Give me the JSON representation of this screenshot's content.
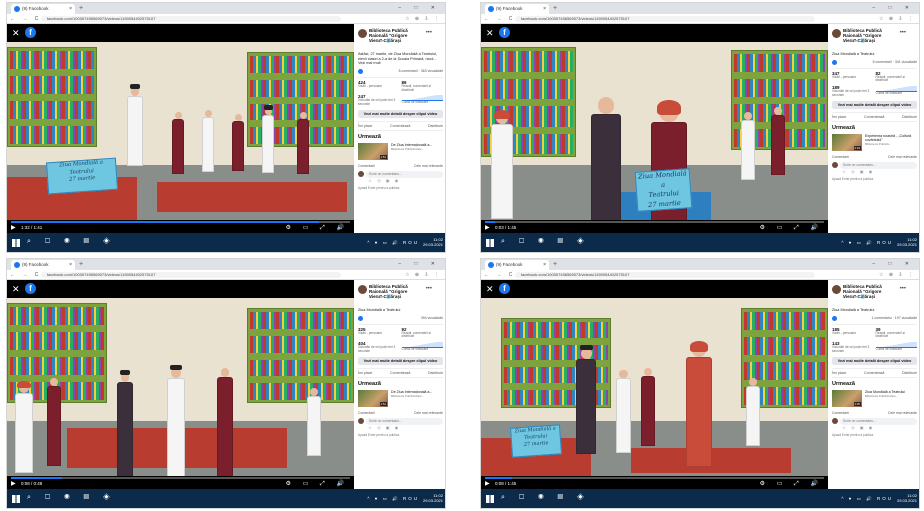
{
  "browser": {
    "tab_title": "(9) Facebook",
    "url": "facebook.com/100057496569073/videos/1159054402575107",
    "new_tab": "+",
    "window_controls": "– □ ✕",
    "nav": "← → C",
    "extensions": "☆ ⊕ ⇩ ⋮"
  },
  "video": {
    "close": "✕",
    "logo": "f",
    "sign_line1": "Ziua Mondială a",
    "sign_line2": "Teatrului",
    "sign_line3": "27 martie",
    "controls_icons": "⚙ ▭ ⤢ 🔊"
  },
  "page": {
    "name": "Biblioteca Publică Raională \"Grigore Vieru\" Călărași",
    "more": "•••"
  },
  "shots": [
    {
      "date": "27 martie · 🌐",
      "caption": "Astăzi, 27 martie, de Ziua Mondială a Teatrului, elevii clasei a 2-a de la Școala Primară, nicol... Vezi mai mult",
      "reactions_right": "8 comentarii · 363 vizualizări",
      "stat1_value": "424",
      "stat1_label": "Vizări - persoane",
      "stat2_value": "86",
      "stat2_label": "Reacții, comentarii și distribuiri",
      "stat3_value": "247",
      "stat3_label": "Vizionări de cel puțin trei 3 secunde",
      "stat4_label": "Curbă de fidelizare",
      "next1_title": "De Ziua Internațională a...",
      "next1_sub": "Biblioteca Publică Raio...",
      "next1_dur": "1:51",
      "video_time": "1:32 / 1:41",
      "progress": 0.91
    },
    {
      "date": "27 martie · 🌐",
      "caption": "Ziua Mondială a Teatrului",
      "reactions_right": "5 comentarii · 341 vizualizări",
      "stat1_value": "347",
      "stat1_label": "Vizări - persoane",
      "stat2_value": "82",
      "stat2_label": "Reacții, comentarii și distribuiri",
      "stat3_value": "189",
      "stat3_label": "Vizionări de cel puțin trei 3 secunde",
      "stat4_label": "Curbă de fidelizare",
      "next1_title": "Experiența noastră - „Cultură cuvântului”",
      "next1_sub": "Biblioteca Publică...",
      "next1_dur": "2:34",
      "video_time": "0:03 / 1:45",
      "progress": 0.03
    },
    {
      "date": "27 martie · 🌐",
      "caption": "Ziua Mondială a Teatrului",
      "reactions_right": "394 vizualizări",
      "stat1_value": "325",
      "stat1_label": "Vizări - persoane",
      "stat2_value": "92",
      "stat2_label": "Reacții, comentarii și distribuiri",
      "stat3_value": "404",
      "stat3_label": "Vizionări de cel puțin trei 3 secunde",
      "stat4_label": "Curbă de fidelizare",
      "next1_title": "De Ziua Internațională a...",
      "next1_sub": "Biblioteca Publică Raio...",
      "next1_dur": "1:51",
      "video_time": "0:08 / 0:49",
      "progress": 0.15
    },
    {
      "date": "27 martie · 🌐",
      "caption": "Ziua Mondială a Teatrului",
      "reactions_right": "1 comentariu · 197 vizualizări",
      "stat1_value": "185",
      "stat1_label": "Vizări - persoane",
      "stat2_value": "39",
      "stat2_label": "Reacții, comentarii și distribuiri",
      "stat3_value": "143",
      "stat3_label": "Vizionări de cel puțin trei 3 secunde",
      "stat4_label": "Curbă de fidelizare",
      "next1_title": "Ziua Mondială a Teatrului",
      "next1_sub": "Biblioteca Publică Raio...",
      "next1_dur": "1:45",
      "video_time": "0:08 / 1:45",
      "progress": 0.08
    }
  ],
  "sidebar": {
    "details_button": "Vezi mai multe detalii despre clipul video",
    "like": "Îmi place",
    "comment": "Comentează",
    "share": "Distribuie",
    "next_heading": "Urmează",
    "comments_label": "Comentarii",
    "most_relevant": "Cele mai relevante",
    "write_comment": "Scrie un comentariu...",
    "emojis": "☺ ◎ ▣ ◉",
    "hint": "Apasă Enter pentru a publica."
  },
  "taskbar": {
    "icons": "⌕ ▢ ◉ ▤ ◈",
    "tray": "^ ● ▭ 🔊 ROU",
    "clock_time": "11:02",
    "clock_date": "29.03.2021"
  }
}
